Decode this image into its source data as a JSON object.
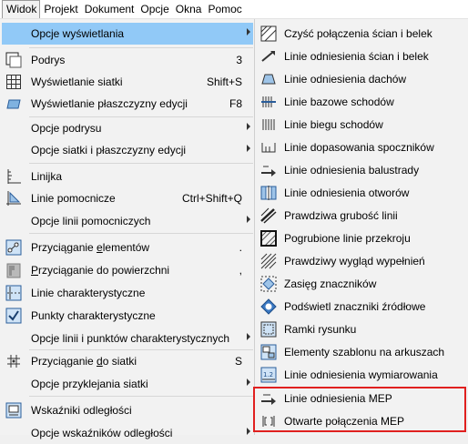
{
  "menubar": {
    "items": [
      "Widok",
      "Projekt",
      "Dokument",
      "Opcje",
      "Okna",
      "Pomoc"
    ]
  },
  "dropdown": {
    "items": [
      {
        "label": "Opcje wyświetlania",
        "shortcut": "",
        "submenu": true
      },
      {
        "label": "Podrys",
        "shortcut": "3"
      },
      {
        "label": "Wyświetlanie siatki",
        "shortcut": "Shift+S"
      },
      {
        "label": "Wyświetlanie płaszczyzny edycji",
        "shortcut": "F8"
      },
      {
        "label": "Opcje podrysu",
        "shortcut": "",
        "submenu": true
      },
      {
        "label": "Opcje siatki i płaszczyzny edycji",
        "shortcut": "",
        "submenu": true
      },
      {
        "label": "Linijka",
        "shortcut": ""
      },
      {
        "label": "Linie pomocnicze",
        "shortcut": "Ctrl+Shift+Q"
      },
      {
        "label": "Opcje linii pomocniczych",
        "shortcut": "",
        "submenu": true
      },
      {
        "label_pre": "Przyciąganie ",
        "label_u": "e",
        "label_post": "lementów",
        "shortcut": "."
      },
      {
        "label_pre": "",
        "label_u": "P",
        "label_post": "rzyciąganie do powierzchni",
        "shortcut": ","
      },
      {
        "label": "Linie charakterystyczne",
        "shortcut": ""
      },
      {
        "label": "Punkty charakterystyczne",
        "shortcut": ""
      },
      {
        "label": "Opcje linii i punktów charakterystycznych",
        "shortcut": "",
        "submenu": true
      },
      {
        "label_pre": "Przyciąganie ",
        "label_u": "d",
        "label_post": "o siatki",
        "shortcut": "S"
      },
      {
        "label": "Opcje przyklejania siatki",
        "shortcut": "",
        "submenu": true
      },
      {
        "label": "Wskaźniki odległości",
        "shortcut": ""
      },
      {
        "label": "Opcje wskaźników odległości",
        "shortcut": "",
        "submenu": true
      }
    ]
  },
  "submenu": {
    "items": [
      {
        "label": "Czyść połączenia ścian i belek",
        "icon": "clean-joins-icon"
      },
      {
        "label": "Linie odniesienia ścian i belek",
        "icon": "reference-line-icon"
      },
      {
        "label": "Linie odniesienia dachów",
        "icon": "roof-reference-icon"
      },
      {
        "label": "Linie bazowe schodów",
        "icon": "stair-baseline-icon"
      },
      {
        "label": "Linie biegu schodów",
        "icon": "stair-walkline-icon"
      },
      {
        "label": "Linie dopasowania spoczników",
        "icon": "landing-fit-icon"
      },
      {
        "label": "Linie odniesienia balustrady",
        "icon": "railing-reference-icon"
      },
      {
        "label": "Linie odniesienia otworów",
        "icon": "opening-reference-icon"
      },
      {
        "label": "Prawdziwa grubość linii",
        "icon": "true-line-weight-icon"
      },
      {
        "label": "Pogrubione linie przekroju",
        "icon": "bold-cut-lines-icon"
      },
      {
        "label": "Prawdziwy wygląd wypełnień",
        "icon": "fill-display-icon"
      },
      {
        "label": "Zasięg znaczników",
        "icon": "marker-range-icon"
      },
      {
        "label": "Podświetl znaczniki źródłowe",
        "icon": "source-marker-icon"
      },
      {
        "label": "Ramki rysunku",
        "icon": "drawing-frame-icon"
      },
      {
        "label": "Elementy szablonu na arkuszach",
        "icon": "master-items-icon"
      },
      {
        "label": "Linie odniesienia wymiarowania",
        "icon": "dimension-reference-icon"
      },
      {
        "label": "Linie odniesienia MEP",
        "icon": "mep-reference-icon"
      },
      {
        "label": "Otwarte połączenia MEP",
        "icon": "mep-connections-icon"
      }
    ]
  },
  "colors": {
    "highlight": "#91c9f7",
    "callout": "#e0201f"
  }
}
